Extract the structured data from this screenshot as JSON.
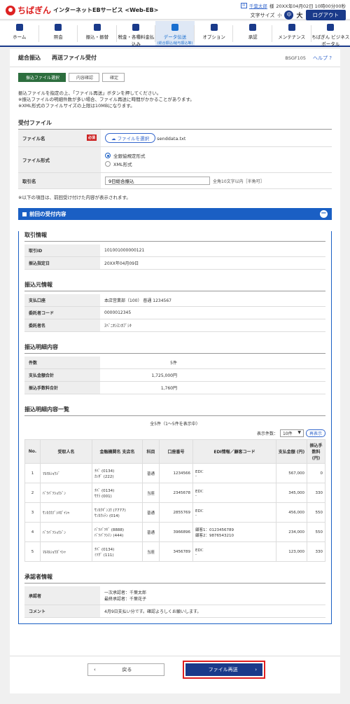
{
  "header": {
    "logo_text": "ちばぎん",
    "service_name": "インターネットEBサービス <Web-EB>",
    "user_name": "千葉太郎",
    "user_suffix": "様",
    "last_login": "20XX年04月02日 10時00分00秒",
    "font_size_label": "文字サイズ",
    "size_small": "小",
    "size_mid": "中",
    "size_large": "大",
    "logout": "ログアウト"
  },
  "nav": {
    "items": [
      {
        "label": "ホーム",
        "icon": "home-icon"
      },
      {
        "label": "照会",
        "icon": "inquiry-icon"
      },
      {
        "label": "振込・振替",
        "icon": "transfer-icon"
      },
      {
        "label": "税金・各種料金払込み",
        "icon": "tax-icon"
      },
      {
        "label": "データ伝送",
        "sub": "(総合振込/給与振込等)",
        "icon": "data-transfer-icon",
        "active": true
      },
      {
        "label": "オプション",
        "icon": "option-icon"
      },
      {
        "label": "承認",
        "icon": "approval-icon"
      },
      {
        "label": "メンテナンス",
        "icon": "maintenance-icon"
      },
      {
        "label": "ちばぎん ビジネスポータル",
        "icon": "portal-icon"
      }
    ]
  },
  "page": {
    "title": "総合振込",
    "subtitle": "再送ファイル受付",
    "screen_code": "BSGF105",
    "help": "ヘルプ"
  },
  "steps": [
    "振込ファイル選択",
    "内容確認",
    "確定"
  ],
  "notes": [
    "振込ファイルを指定の上、「ファイル再送」ボタンを押してください。",
    "※振込ファイルの明細件数が多い場合、ファイル再送に時間がかかることがあります。",
    "※XML形式のファイルサイズの上限は10MBになります。"
  ],
  "upload": {
    "section_title": "受付ファイル",
    "file_label": "ファイル名",
    "required": "必須",
    "file_button": "ファイルを選択",
    "file_name": "senddata.txt",
    "format_label": "ファイル形式",
    "format_options": [
      "全銀協規定形式",
      "XML形式"
    ],
    "torikumi_label": "取引名",
    "torikumi_value": "9日総合振込",
    "torikumi_hint": "全角10文字以内［半角可］"
  },
  "prev_note": "※以下の項目は、前回受け付けた内容が表示されます。",
  "prev_panel": {
    "title": "前回の受付内容",
    "trans_section": "取引情報",
    "trans_rows": [
      {
        "label": "取引ID",
        "value": "101001000000121"
      },
      {
        "label": "振込指定日",
        "value": "20XX年04月09日"
      }
    ],
    "source_section": "振込元情報",
    "source_rows": [
      {
        "label": "支払口座",
        "value": "本店営業部（100） 普通 1234567"
      },
      {
        "label": "委託者コード",
        "value": "0000012345"
      },
      {
        "label": "委託者名",
        "value": "ｽﾍﾞﾆｵｼｽﾝｶﾌﾞｼｷ"
      }
    ],
    "detail_section": "振込明細内容",
    "detail_rows": [
      {
        "label": "件数",
        "value": "5件"
      },
      {
        "label": "支払金額合計",
        "value": "1,725,000円"
      },
      {
        "label": "振込手数料合計",
        "value": "1,760円"
      }
    ],
    "list_section": "振込明細内容一覧",
    "list_meta": "全5件（1～5件を表示中）",
    "display_count_label": "表示件数：",
    "display_count": "10件",
    "redisplay": "再表示",
    "columns": [
      "No.",
      "受取人名",
      "金融機関名 支店名",
      "科目",
      "口座番号",
      "EDI情報／顧客コード",
      "支払金額 (円)",
      "振込手数料 (円)"
    ],
    "rows": [
      {
        "no": "1",
        "name": "ﾏﾙﾏﾙｼｮｳｼﾞ",
        "bank": "ﾁﾊﾞ (0134)",
        "branch": "ｶﾝﾀﾞ (222)",
        "type": "普通",
        "acct": "1234566",
        "edi1": "EDI：",
        "edi2": "-",
        "amount": "567,000",
        "fee": "0"
      },
      {
        "no": "2",
        "name": "ﾊﾞﾂﾊﾞﾂｼｮｳｼﾞﾝ",
        "bank": "ﾁﾊﾞ (0134)",
        "branch": "ｻｸﾗ (001)",
        "type": "当座",
        "acct": "2345678",
        "edi1": "EDI：",
        "edi2": "-",
        "amount": "345,000",
        "fee": "330"
      },
      {
        "no": "3",
        "name": "ｻﾝｶｸｶﾌﾞｼｷｶﾞｲｼｬ",
        "bank": "ｻﾝｶｸｷﾞﾝｺｳ (7777)",
        "branch": "ｻﾝｶｸｼﾃﾝ (014)",
        "type": "普通",
        "acct": "2855769",
        "edi1": "EDI：",
        "edi2": "-",
        "amount": "456,000",
        "fee": "550"
      },
      {
        "no": "4",
        "name": "ﾊﾞﾂﾊﾞﾂｼｮｳｼﾞﾝ",
        "bank": "ﾊﾞﾂﾊﾞﾂｷﾞ (8888)",
        "branch": "ﾊﾞﾂﾊﾞﾂｼﾃﾝ (444)",
        "type": "普通",
        "acct": "3966896",
        "edi1": "顧客1：0123456789",
        "edi2": "顧客2：9876543210",
        "amount": "234,000",
        "fee": "550"
      },
      {
        "no": "5",
        "name": "ﾏﾙﾏﾙｼｮｳｶﾞｲｼｬ",
        "bank": "ﾁﾊﾞ (0134)",
        "branch": "ﾐﾂｸﾞ (111)",
        "type": "当座",
        "acct": "3456789",
        "edi1": "EDI：",
        "edi2": "-",
        "amount": "123,000",
        "fee": "330"
      }
    ],
    "approver_section": "承認者情報",
    "approver_label": "承認者",
    "approver1": "一次承認者：千葉太郎",
    "approver2": "最終承認者：千葉花子",
    "comment_label": "コメント",
    "comment": "4月9日支払い分です。確認よろしくお願いします。"
  },
  "buttons": {
    "back": "戻る",
    "resend": "ファイル再送"
  }
}
